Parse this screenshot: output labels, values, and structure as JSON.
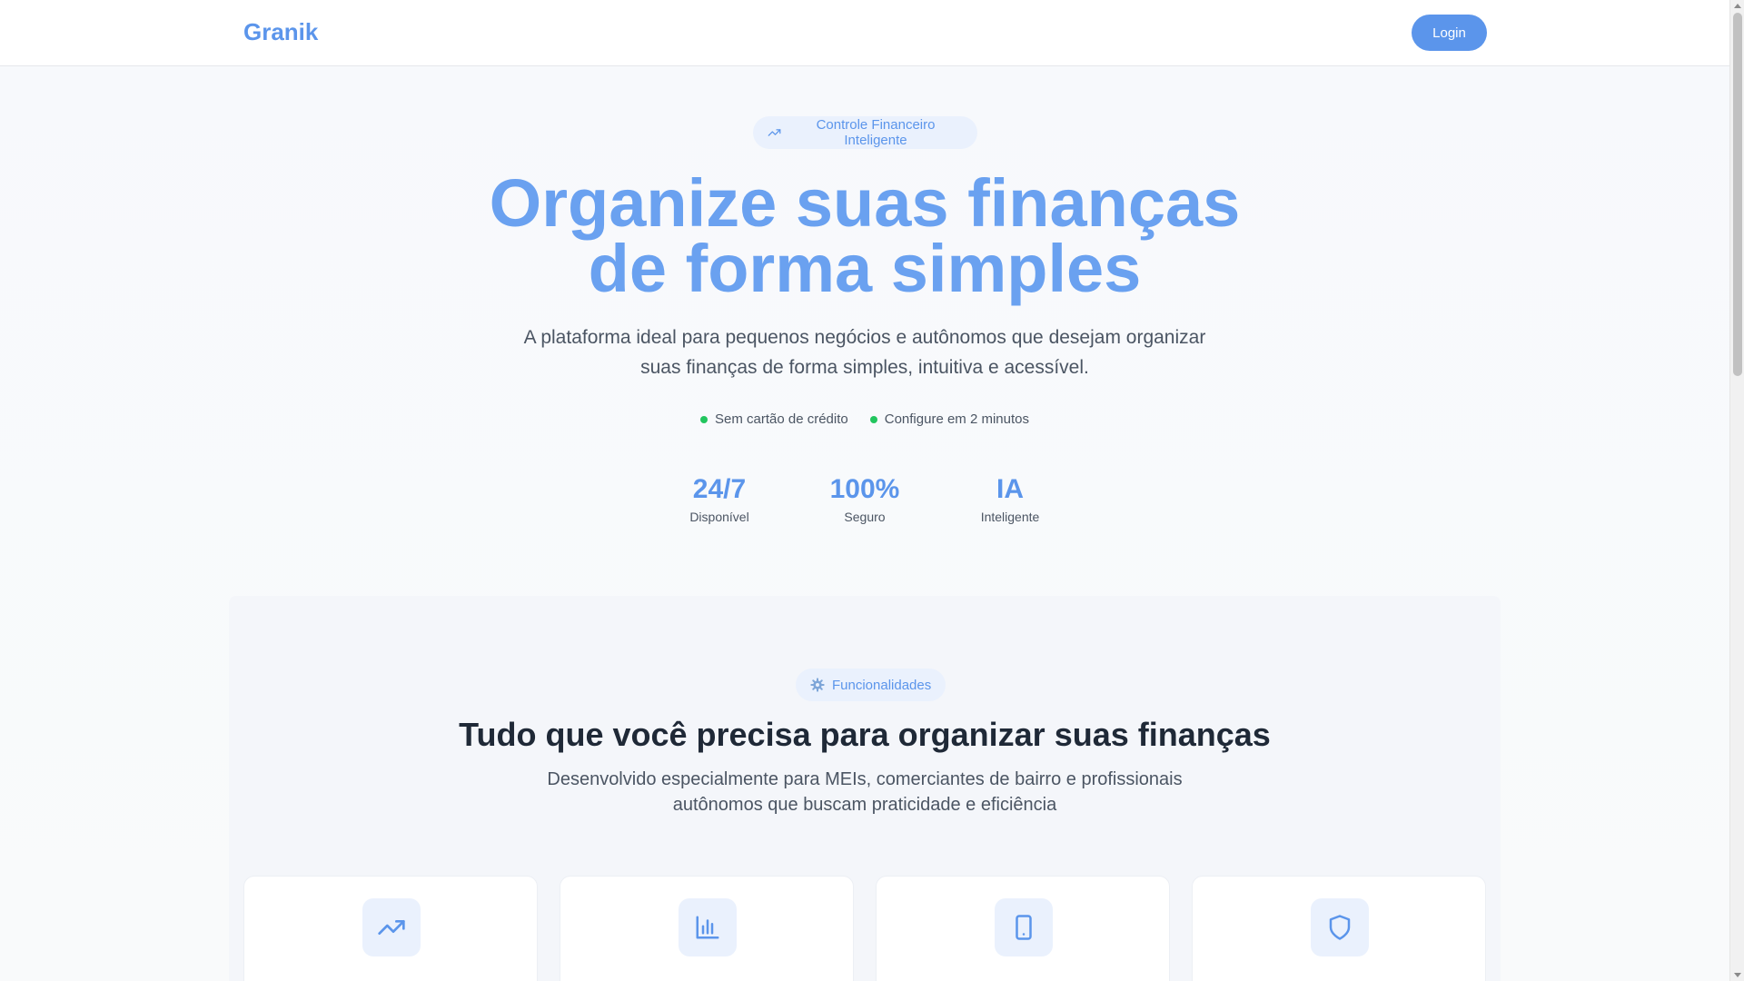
{
  "header": {
    "logo": "Granik",
    "login_label": "Login"
  },
  "hero": {
    "badge": "Controle Financeiro Inteligente",
    "title_line1": "Organize suas finanças",
    "title_line2": "de forma simples",
    "subtitle": "A plataforma ideal para pequenos negócios e autônomos que desejam organizar suas finanças de forma simples, intuitiva e acessível.",
    "checks": [
      "Sem cartão de crédito",
      "Configure em 2 minutos"
    ],
    "stats": [
      {
        "value": "24/7",
        "label": "Disponível"
      },
      {
        "value": "100%",
        "label": "Seguro"
      },
      {
        "value": "IA",
        "label": "Inteligente"
      }
    ]
  },
  "features": {
    "badge": "Funcionalidades",
    "title": "Tudo que você precisa para organizar suas finanças",
    "subtitle": "Desenvolvido especialmente para MEIs, comerciantes de bairro e profissionais autônomos que buscam praticidade e eficiência",
    "card_icons": [
      "trending-up-icon",
      "bar-chart-icon",
      "smartphone-icon",
      "shield-icon"
    ]
  },
  "colors": {
    "accent": "#5b95eb",
    "success": "#22c55e",
    "text_dark": "#1f2937",
    "text_muted": "#4b5563"
  }
}
